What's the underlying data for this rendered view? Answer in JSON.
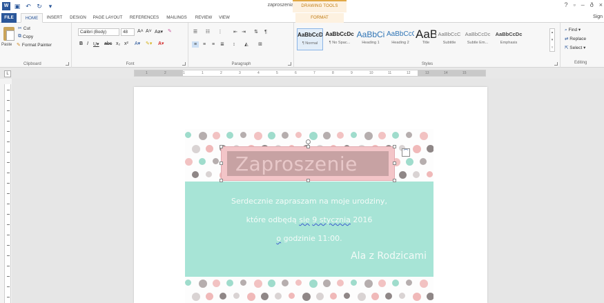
{
  "app": {
    "doc_title": "zaproszenia_kropki.docx - Word",
    "tools_group": "DRAWING TOOLS",
    "signin": "Sign",
    "window_controls": [
      "?",
      "▫",
      "–",
      "ð",
      "×"
    ]
  },
  "tabs": [
    {
      "label": "FILE",
      "kind": "file"
    },
    {
      "label": "HOME",
      "kind": "active"
    },
    {
      "label": "INSERT",
      "kind": "normal"
    },
    {
      "label": "DESIGN",
      "kind": "normal"
    },
    {
      "label": "PAGE LAYOUT",
      "kind": "normal"
    },
    {
      "label": "REFERENCES",
      "kind": "normal"
    },
    {
      "label": "MAILINGS",
      "kind": "normal"
    },
    {
      "label": "REVIEW",
      "kind": "normal"
    },
    {
      "label": "VIEW",
      "kind": "normal"
    },
    {
      "label": "FORMAT",
      "kind": "format"
    }
  ],
  "clipboard": {
    "paste": "Paste",
    "cut": "Cut",
    "copy": "Copy",
    "format_painter": "Format Painter",
    "label": "Clipboard"
  },
  "font": {
    "family": "Calibri (Body)",
    "size": "48",
    "label": "Font"
  },
  "paragraph": {
    "label": "Paragraph"
  },
  "styles": {
    "label": "Styles",
    "items": [
      {
        "sample": "AaBbCcDc",
        "name": "¶ Normal",
        "selected": true
      },
      {
        "sample": "AaBbCcDc",
        "name": "¶ No Spac...",
        "selected": false
      },
      {
        "sample": "AaBbCi",
        "name": "Heading 1",
        "selected": false
      },
      {
        "sample": "AaBbCcC",
        "name": "Heading 2",
        "selected": false
      },
      {
        "sample": "AaBI",
        "name": "Title",
        "selected": false
      },
      {
        "sample": "AaBbCcC",
        "name": "Subtitle",
        "selected": false
      },
      {
        "sample": "AaBbCcDc",
        "name": "Subtle Em...",
        "selected": false
      },
      {
        "sample": "AaBbCcDc",
        "name": "Emphasis",
        "selected": false
      }
    ]
  },
  "editing": {
    "find": "Find",
    "replace": "Replace",
    "select": "Select",
    "label": "Editing"
  },
  "ruler": {
    "numbers": [
      "1",
      "2",
      "1",
      "1",
      "2",
      "3",
      "4",
      "5",
      "6",
      "7",
      "8",
      "9",
      "10",
      "11",
      "12",
      "13",
      "14",
      "15"
    ]
  },
  "document": {
    "title": "Zaproszenie",
    "line1": "Serdecznie zapraszam na moje urodziny,",
    "line2_pre": "które odbędą ",
    "line2_err1": "sie",
    "line2_space": " ",
    "line2_err2": " 9 stycznia",
    "line2_post": " 2016",
    "line3_err": "o",
    "line3_post": " godzinie 11:00.",
    "signature": "Ala z Rodzicami"
  },
  "colors": {
    "accent": "#2b579a",
    "invite_bg": "#a7e4d6",
    "title_bg": "#f3c5c8",
    "dot_palette": [
      "#9fdccc",
      "#f0b9b9",
      "#b6aeae",
      "#8f8787",
      "#f2c2c2",
      "#d9d3d3"
    ]
  }
}
